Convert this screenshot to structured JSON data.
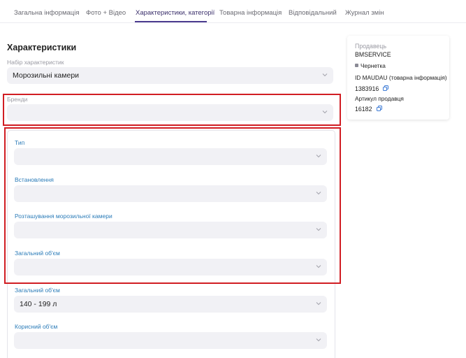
{
  "tabs": [
    {
      "label": "Загальна інформація"
    },
    {
      "label": "Фото + Відео"
    },
    {
      "label": "Характеристики, категорії"
    },
    {
      "label": "Товарна інформація"
    },
    {
      "label": "Відповідальний"
    },
    {
      "label": "Журнал змін"
    }
  ],
  "active_tab": "Характеристики, категорії",
  "section_title": "Характеристики",
  "characteristic_set": {
    "label": "Набір характеристик",
    "value": "Морозильні камери"
  },
  "brands": {
    "label": "Бренди",
    "value": ""
  },
  "group_fields": [
    {
      "label": "Тип",
      "value": ""
    },
    {
      "label": "Встановлення",
      "value": ""
    },
    {
      "label": "Розташування морозильної камери",
      "value": ""
    },
    {
      "label": "Загальний об'єм",
      "value": ""
    }
  ],
  "lower_fields": [
    {
      "label": "Загальний об'єм",
      "value": "140 - 199 л"
    },
    {
      "label": "Корисний об'єм",
      "value": ""
    }
  ],
  "seller": {
    "heading": "Продавець",
    "name": "BMSERVICE",
    "status": "Чернетка",
    "id_label": "ID MAUDAU (товарна інформація)",
    "id_value": "1383916",
    "article_label": "Артикул продавця",
    "article_value": "16182"
  },
  "colors": {
    "accent": "#4b3b8f",
    "highlight": "#d11d23",
    "label_blue": "#2a7bb8",
    "field_bg": "#f1f1f5"
  },
  "icons": [
    "chevron-down-icon",
    "copy-icon"
  ]
}
